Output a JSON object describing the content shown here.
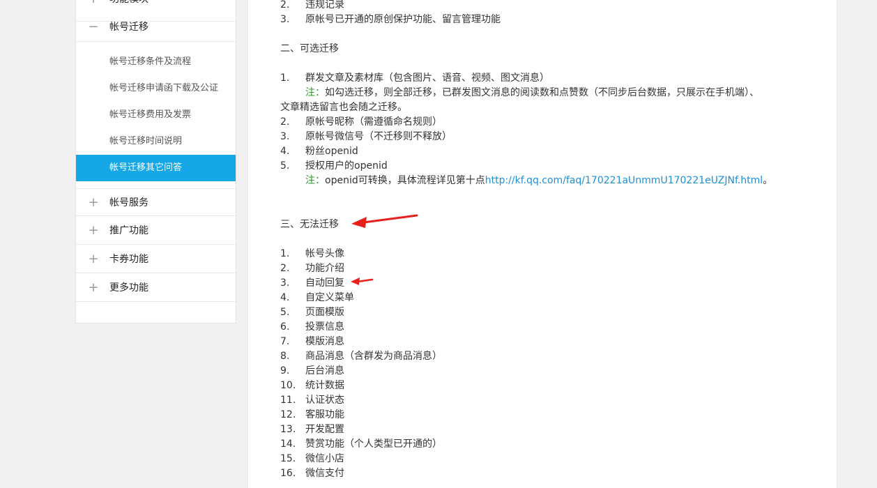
{
  "sidebar": {
    "top_cut_item": "功能模块",
    "account_migration": "帐号迁移",
    "sub_items": [
      "帐号迁移条件及流程",
      "帐号迁移申请函下载及公证",
      "帐号迁移费用及发票",
      "帐号迁移时间说明",
      "帐号迁移其它问答"
    ],
    "menu_items": [
      "帐号服务",
      "推广功能",
      "卡券功能",
      "更多功能"
    ]
  },
  "content": {
    "top_items": [
      {
        "num": "2.",
        "text": "违规记录"
      },
      {
        "num": "3.",
        "text": "原帐号已开通的原创保护功能、留言管理功能"
      }
    ],
    "section2_title": "二、可选迁移",
    "section2_items": [
      {
        "num": "1.",
        "text": "群发文章及素材库（包含图片、语音、视频、图文消息）"
      },
      {
        "num": "2.",
        "text": "原帐号昵称（需遵循命名规则）"
      },
      {
        "num": "3.",
        "text": "原帐号微信号（不迁移则不释放）"
      },
      {
        "num": "4.",
        "text": "粉丝openid"
      },
      {
        "num": "5.",
        "text": "授权用户的openid"
      }
    ],
    "note1_label": "注：",
    "note1_text": "如勾选迁移，则全部迁移，已群发图文消息的阅读数和点赞数（不同步后台数据，只展示在手机端）、",
    "note1_cont": "文章精选留言也会随之迁移。",
    "note2_label": "注：",
    "note2_text": "openid可转换，具体流程详见第十点",
    "note2_link": "http://kf.qq.com/faq/170221aUnmmU170221eUZJNf.html",
    "note2_end": "。",
    "section3_title": "三、无法迁移",
    "section3_items": [
      {
        "num": "1.",
        "text": "帐号头像"
      },
      {
        "num": "2.",
        "text": "功能介绍"
      },
      {
        "num": "3.",
        "text": "自动回复"
      },
      {
        "num": "4.",
        "text": "自定义菜单"
      },
      {
        "num": "5.",
        "text": "页面模版"
      },
      {
        "num": "6.",
        "text": "投票信息"
      },
      {
        "num": "7.",
        "text": "模版消息"
      },
      {
        "num": "8.",
        "text": "商品消息（含群发为商品消息）"
      },
      {
        "num": "9.",
        "text": "后台消息"
      },
      {
        "num": "10.",
        "text": "统计数据"
      },
      {
        "num": "11.",
        "text": "认证状态"
      },
      {
        "num": "12.",
        "text": "客服功能"
      },
      {
        "num": "13.",
        "text": "开发配置"
      },
      {
        "num": "14.",
        "text": "赞赏功能（个人类型已开通的）"
      },
      {
        "num": "15.",
        "text": "微信小店"
      },
      {
        "num": "16.",
        "text": "微信支付"
      }
    ]
  },
  "colors": {
    "accent": "#16a8e6",
    "link": "#1e90d8",
    "note": "#2a9d2a",
    "arrow": "#e8201c"
  },
  "icons": {
    "expand": "plus-icon",
    "collapse": "minus-icon"
  }
}
